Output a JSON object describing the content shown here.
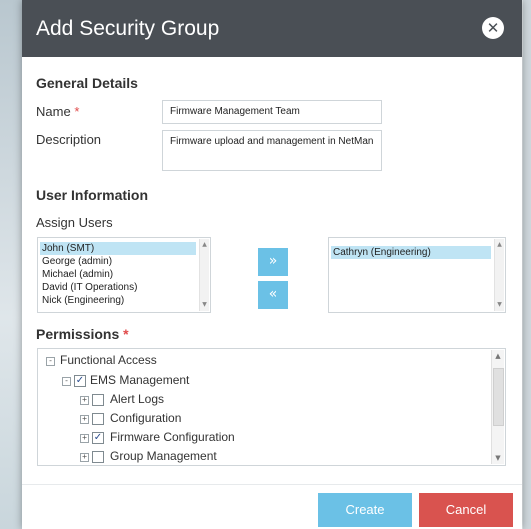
{
  "dialog": {
    "title": "Add Security Group",
    "close_icon": "close-circle-icon"
  },
  "general": {
    "heading": "General Details",
    "name_label": "Name",
    "required_mark": "*",
    "name_value": "Firmware Management Team",
    "description_label": "Description",
    "description_value": "Firmware upload and management in NetMan"
  },
  "users": {
    "heading": "User Information",
    "assign_label": "Assign Users",
    "available": [
      {
        "label": "John (SMT)",
        "selected": true
      },
      {
        "label": "George (admin)",
        "selected": false
      },
      {
        "label": "Michael (admin)",
        "selected": false
      },
      {
        "label": "David (IT Operations)",
        "selected": false
      },
      {
        "label": "Nick (Engineering)",
        "selected": false
      }
    ],
    "assigned": [
      {
        "label": "Cathryn (Engineering)",
        "selected": true
      }
    ],
    "add_button": "»",
    "remove_button": "«"
  },
  "permissions": {
    "heading": "Permissions",
    "required_mark": "*",
    "tree": [
      {
        "label": "Functional Access",
        "expander": "-",
        "checkbox": null
      },
      {
        "label": "EMS Management",
        "expander": "-",
        "checkbox": true
      },
      {
        "label": "Alert Logs",
        "expander": "+",
        "checkbox": false
      },
      {
        "label": "Configuration",
        "expander": "+",
        "checkbox": false
      },
      {
        "label": "Firmware Configuration",
        "expander": "+",
        "checkbox": true
      },
      {
        "label": "Group Management",
        "expander": "+",
        "checkbox": false
      }
    ]
  },
  "footer": {
    "create_label": "Create",
    "cancel_label": "Cancel"
  },
  "colors": {
    "header": "#4a4f55",
    "accent": "#6bc1e6",
    "danger": "#d9534f",
    "selection": "#bfe4f4"
  }
}
